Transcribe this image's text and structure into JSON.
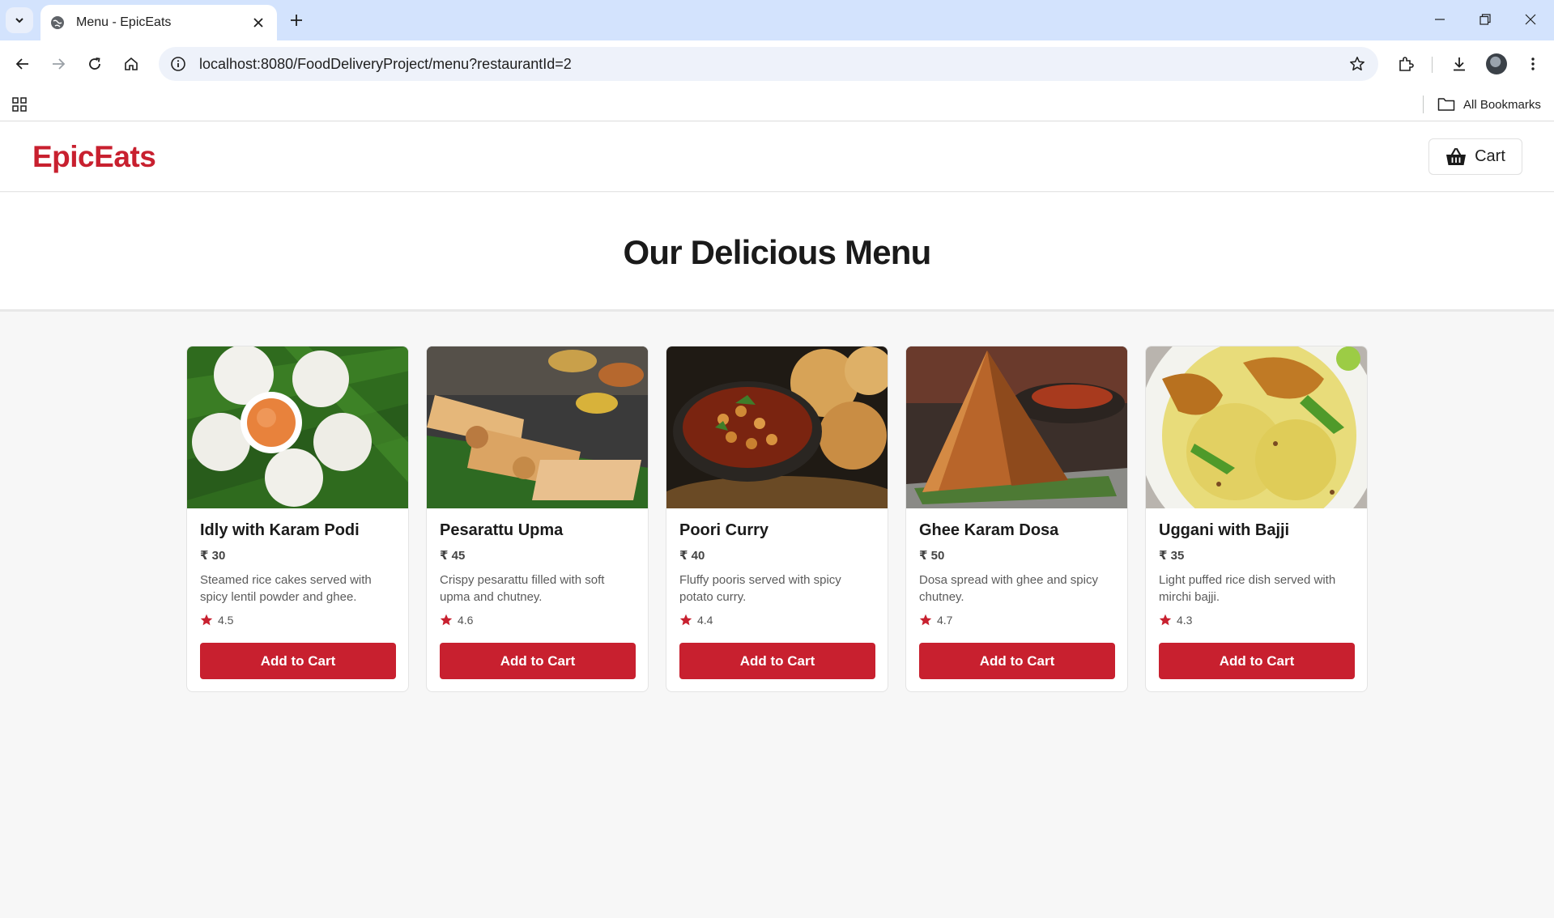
{
  "browser": {
    "tab_title": "Menu - EpicEats",
    "url": "localhost:8080/FoodDeliveryProject/menu?restaurantId=2",
    "bookmarks_label": "All Bookmarks"
  },
  "site": {
    "logo": "EpicEats",
    "cart_label": "Cart",
    "hero_title": "Our Delicious Menu",
    "accent_color": "#c8202f"
  },
  "menu": {
    "items": [
      {
        "name": "Idly with Karam Podi",
        "price": "₹ 30",
        "description": "Steamed rice cakes served with spicy lentil powder and ghee.",
        "rating": "4.5",
        "button": "Add to Cart"
      },
      {
        "name": "Pesarattu Upma",
        "price": "₹ 45",
        "description": "Crispy pesarattu filled with soft upma and chutney.",
        "rating": "4.6",
        "button": "Add to Cart"
      },
      {
        "name": "Poori Curry",
        "price": "₹ 40",
        "description": "Fluffy pooris served with spicy potato curry.",
        "rating": "4.4",
        "button": "Add to Cart"
      },
      {
        "name": "Ghee Karam Dosa",
        "price": "₹ 50",
        "description": "Dosa spread with ghee and spicy chutney.",
        "rating": "4.7",
        "button": "Add to Cart"
      },
      {
        "name": "Uggani with Bajji",
        "price": "₹ 35",
        "description": "Light puffed rice dish served with mirchi bajji.",
        "rating": "4.3",
        "button": "Add to Cart"
      }
    ]
  }
}
